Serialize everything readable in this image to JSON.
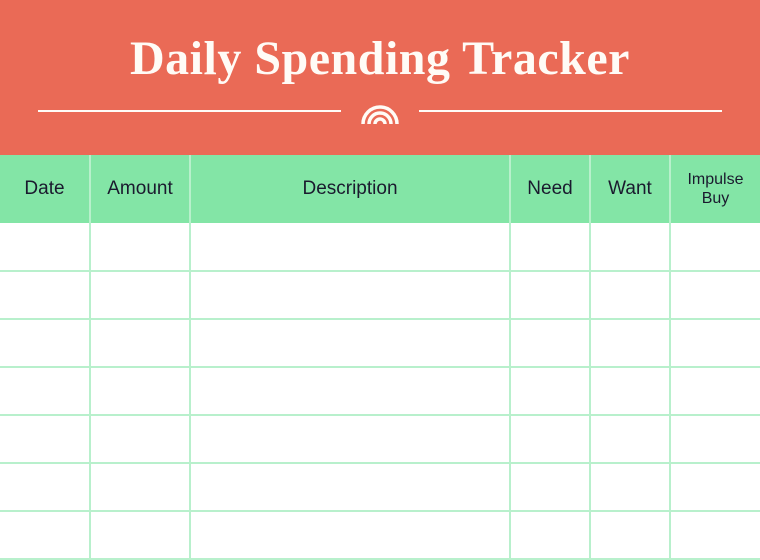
{
  "header": {
    "title": "Daily Spending Tracker"
  },
  "table": {
    "columns": [
      {
        "label": "Date"
      },
      {
        "label": "Amount"
      },
      {
        "label": "Description"
      },
      {
        "label": "Need"
      },
      {
        "label": "Want"
      },
      {
        "label": "Impulse Buy"
      }
    ],
    "row_count": 7
  }
}
